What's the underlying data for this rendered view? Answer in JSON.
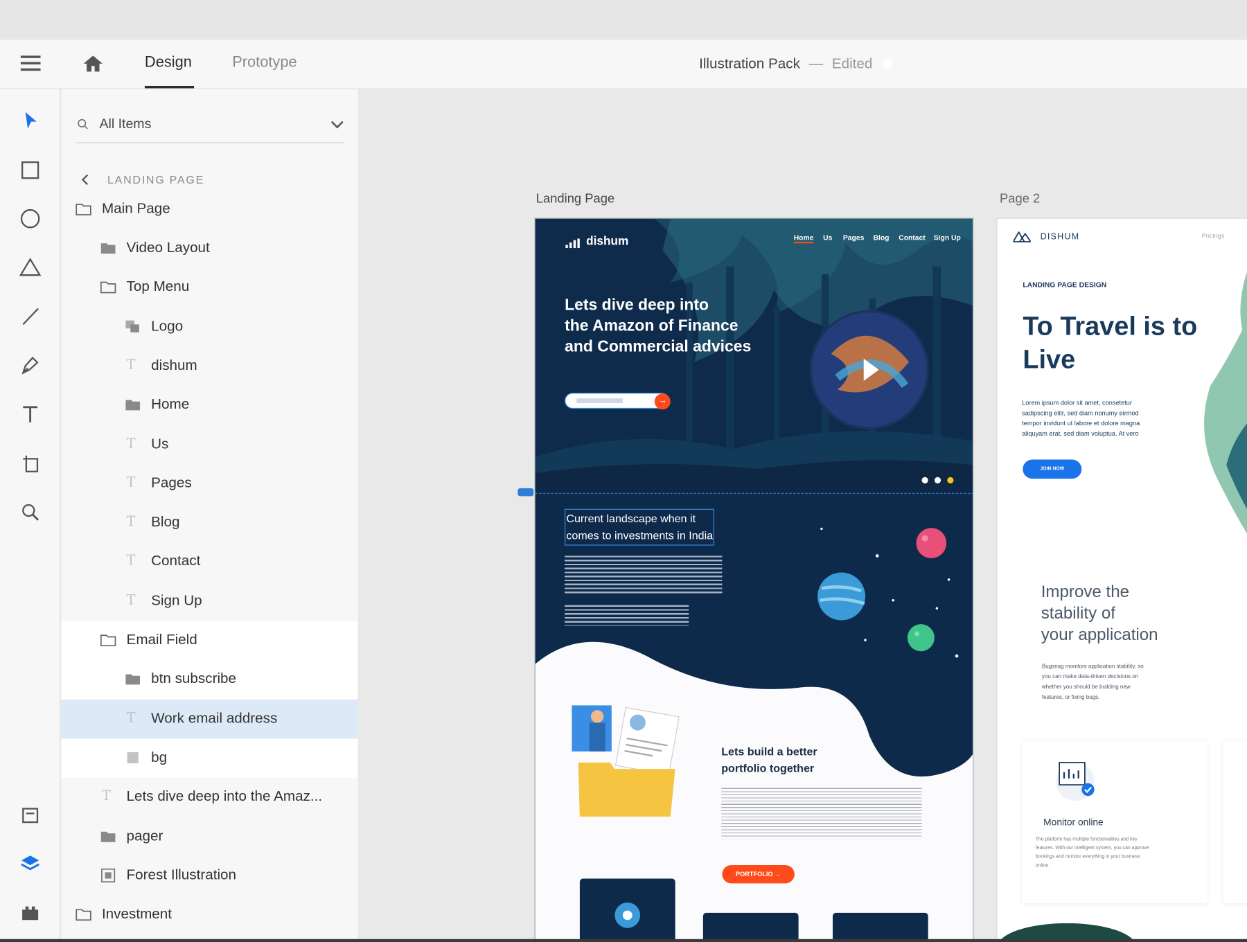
{
  "header": {
    "tabs": [
      {
        "label": "Design"
      },
      {
        "label": "Prototype"
      }
    ],
    "document_title": "Illustration Pack",
    "separator": "—",
    "document_status": "Edited"
  },
  "toolbar": {
    "tools": [
      "select-icon",
      "rectangle-icon",
      "ellipse-icon",
      "triangle-icon",
      "line-icon",
      "pen-icon",
      "text-icon",
      "artboard-icon",
      "zoom-icon"
    ],
    "bottom_tools": [
      "assets-icon",
      "layers-icon",
      "plugins-icon"
    ]
  },
  "layers_panel": {
    "search": {
      "value": "All Items"
    },
    "section_label": "LANDING PAGE",
    "items": [
      {
        "label": "Main Page",
        "icon": "folder-outline-icon"
      },
      {
        "label": "Video Layout",
        "icon": "folder-filled-icon"
      },
      {
        "label": "Top Menu",
        "icon": "folder-outline-icon"
      },
      {
        "label": "Logo",
        "icon": "group-icon"
      },
      {
        "label": "dishum",
        "icon": "text-layer-icon"
      },
      {
        "label": "Home",
        "icon": "folder-filled-icon"
      },
      {
        "label": "Us",
        "icon": "text-layer-icon"
      },
      {
        "label": "Pages",
        "icon": "text-layer-icon"
      },
      {
        "label": "Blog",
        "icon": "text-layer-icon"
      },
      {
        "label": "Contact",
        "icon": "text-layer-icon"
      },
      {
        "label": "Sign Up",
        "icon": "text-layer-icon"
      },
      {
        "label": "Email Field",
        "icon": "folder-outline-icon"
      },
      {
        "label": "btn subscribe",
        "icon": "folder-filled-icon"
      },
      {
        "label": "Work email address",
        "icon": "text-layer-icon"
      },
      {
        "label": "bg",
        "icon": "rectangle-layer-icon"
      },
      {
        "label": "Lets dive deep into the Amaz...",
        "icon": "text-layer-icon"
      },
      {
        "label": "pager",
        "icon": "folder-filled-icon"
      },
      {
        "label": "Forest Illustration",
        "icon": "image-layer-icon"
      },
      {
        "label": "Investment",
        "icon": "folder-outline-icon"
      }
    ]
  },
  "canvas": {
    "artboard1": {
      "name": "Landing Page",
      "brand": "dishum",
      "nav": [
        "Home",
        "Us",
        "Pages",
        "Blog",
        "Contact",
        "Sign Up"
      ],
      "hero_title": [
        "Lets dive deep into",
        "the Amazon of Finance",
        "and Commercial advices"
      ],
      "section_title": [
        "Current landscape when it",
        "comes to investments in India"
      ],
      "portfolio_title": [
        "Lets build a better",
        "portfolio together"
      ],
      "portfolio_button": "PORTFOLIO"
    },
    "artboard2": {
      "name": "Page 2",
      "brand": "DISHUM",
      "nav_right": "Pricings",
      "eyebrow": "LANDING PAGE DESIGN",
      "title": [
        "To Travel is to",
        "Live"
      ],
      "body": [
        "Lorem ipsum dolor sit amet, consetetur",
        "sadipscing elitr, sed diam nonumy eirmod",
        "tempor invidunt ut labore et dolore magna",
        "aliquyam erat, sed diam voluptua. At vero"
      ],
      "button": "JOIN NOW",
      "feature_title": [
        "Improve the",
        "stability of",
        "your application"
      ],
      "feature_body": [
        "Bugsnag monitors application stability, so",
        "you can make data-driven decisions on",
        "whether you should be building new",
        "features, or fixing bugs."
      ],
      "card_title": "Monitor online",
      "card_body": [
        "The platform has multiple functionalities and key",
        "features. With our intelligent system, you can approve",
        "bookings and monitor everything in your business",
        "online."
      ]
    }
  },
  "colors": {
    "accent": "#1a73e8",
    "selection": "#dde9f6",
    "dark_navy": "#0e2a4b",
    "orange": "#ff4a1c",
    "brand_blue": "#1a3a5c"
  }
}
